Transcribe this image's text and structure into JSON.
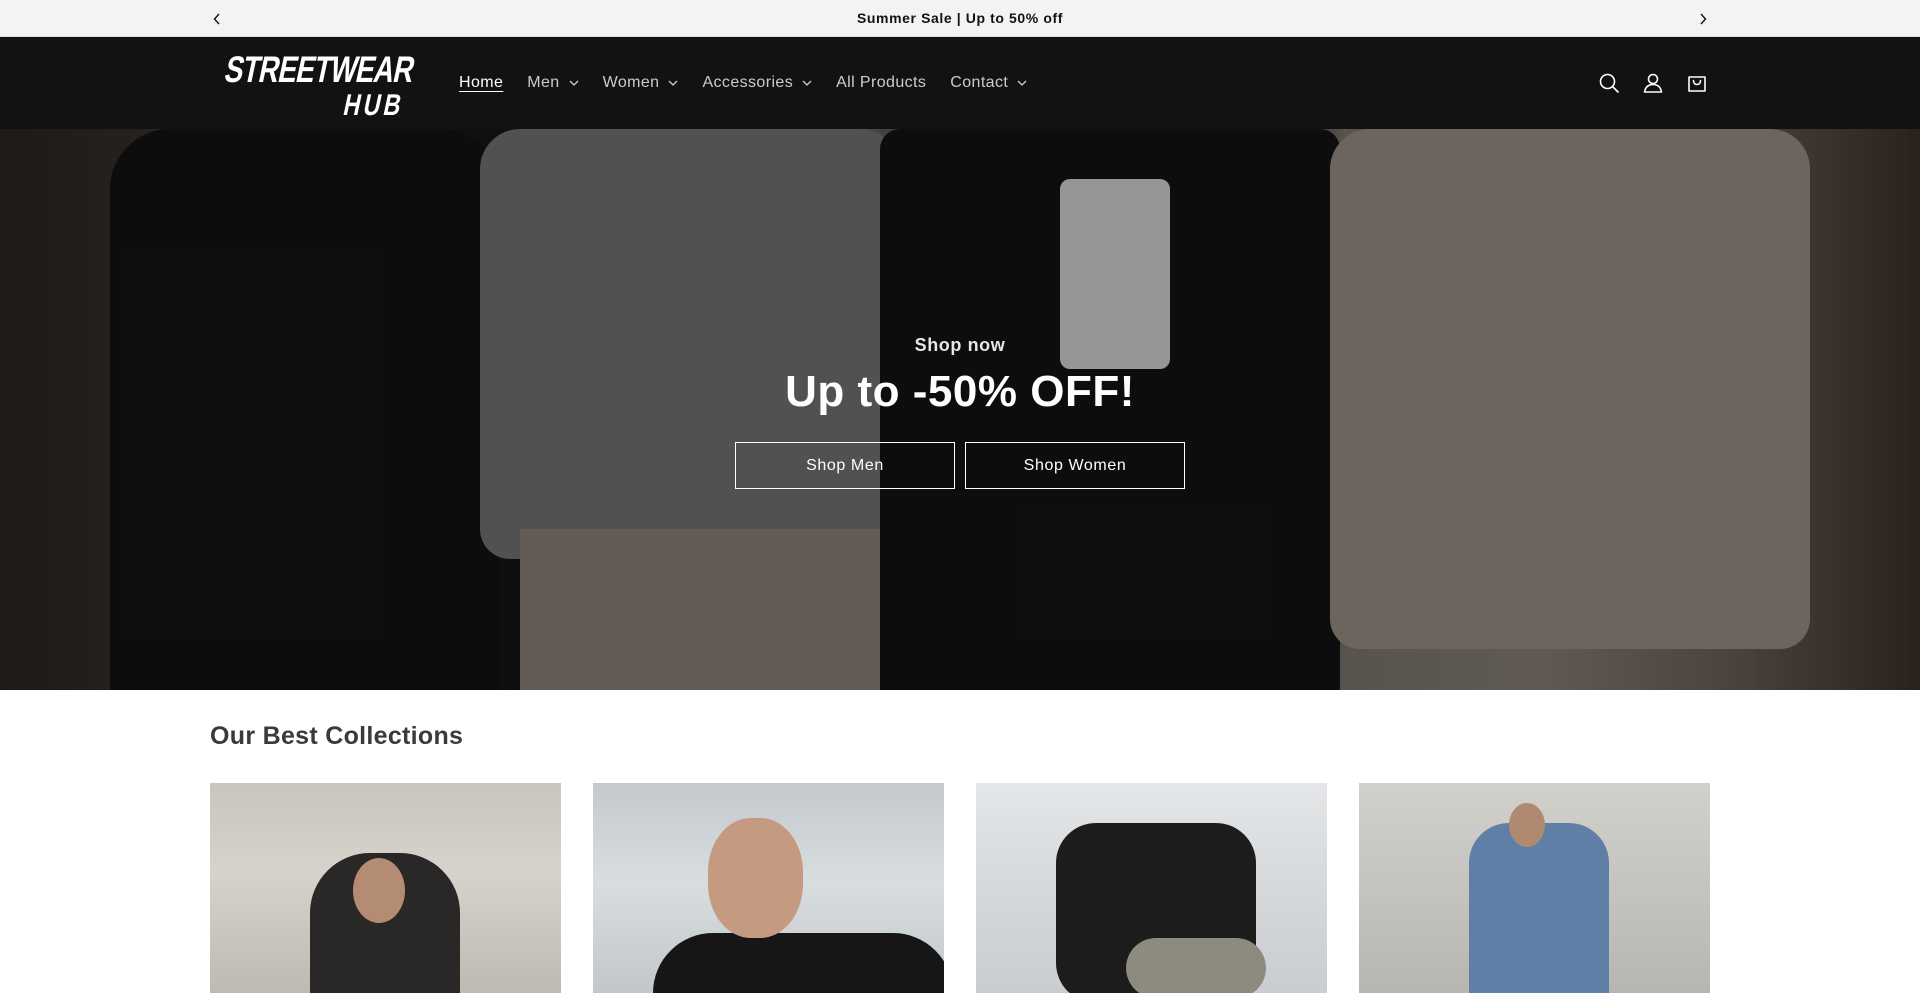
{
  "announcement": {
    "text": "Summer Sale | Up to 50% off",
    "prev_icon": "chevron-left-icon",
    "next_icon": "chevron-right-icon"
  },
  "header": {
    "logo_text": "STREETWEAR HUB",
    "nav": [
      {
        "label": "Home",
        "active": true,
        "has_dropdown": false
      },
      {
        "label": "Men",
        "active": false,
        "has_dropdown": true
      },
      {
        "label": "Women",
        "active": false,
        "has_dropdown": true
      },
      {
        "label": "Accessories",
        "active": false,
        "has_dropdown": true
      },
      {
        "label": "All Products",
        "active": false,
        "has_dropdown": false
      },
      {
        "label": "Contact",
        "active": false,
        "has_dropdown": true
      }
    ],
    "icons": [
      "search-icon",
      "account-icon",
      "cart-icon"
    ]
  },
  "hero": {
    "eyebrow": "Shop now",
    "title": "Up to -50% OFF!",
    "buttons": {
      "men": "Shop Men",
      "women": "Shop Women"
    }
  },
  "collections": {
    "title": "Our Best Collections",
    "cards": [
      {
        "image": "woman-black-satin-shirt"
      },
      {
        "image": "man-black-polo"
      },
      {
        "image": "man-sneakers-shorts"
      },
      {
        "image": "woman-denim-set"
      }
    ]
  },
  "colors": {
    "header_bg": "#121212",
    "announcement_bg": "#f3f3f3",
    "text": "#121212"
  }
}
